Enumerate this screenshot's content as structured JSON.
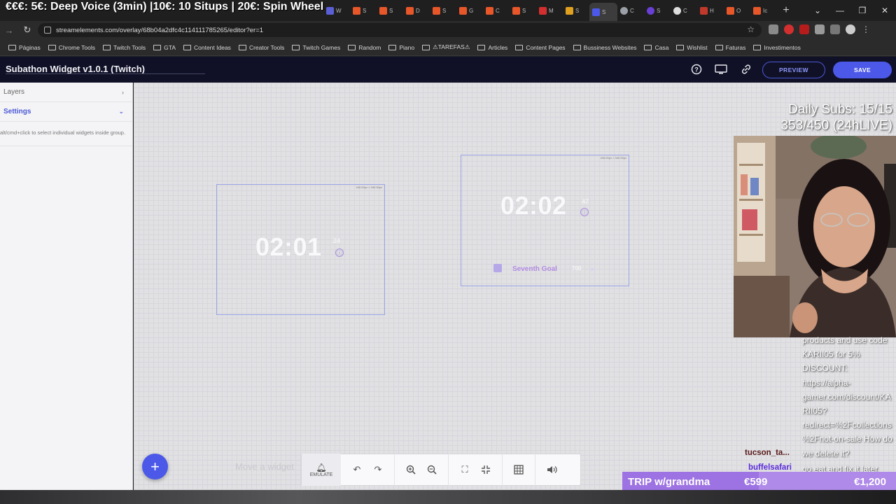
{
  "stream_overlay": {
    "top_banner": "€€€: 5€: Deep Voice (3min) |10€: 10 Situps | 20€: Spin Wheel",
    "subs_line1": "Daily Subs: 15/15",
    "subs_line2": "353/450 (24hLIVE)",
    "chat_text": "products and use code KARII05 for 5% DISCOUNT: https://alpha-gamer.com/discount/KARII05?redirect=%2Fcollections%2Fnot-on-sale How do we delete it?",
    "chat_user1": "tucson_ta...",
    "chat_user2": "buffelsafari",
    "chat_tail": "go eat and fix it later",
    "trip_label": "TRIP w/grandma",
    "trip_current": "€599",
    "trip_goal": "€1,200",
    "trip_progress": 0.499
  },
  "browser": {
    "tabs": [
      "W",
      "S",
      "S",
      "D",
      "S",
      "G",
      "C",
      "S",
      "M",
      "S",
      "S",
      "C",
      "S",
      "C",
      "H",
      "O",
      "Ic"
    ],
    "url": "streamelements.com/overlay/68b04a2dfc4c114111785265/editor?er=1",
    "bookmarks": [
      "Páginas",
      "Chrome Tools",
      "Twitch Tools",
      "GTA",
      "Content Ideas",
      "Creator Tools",
      "Twitch Games",
      "Random",
      "Piano",
      "⚠TAREFAS⚠",
      "Articles",
      "Content Pages",
      "Bussiness Websites",
      "Casa",
      "Wishlist",
      "Faturas",
      "Investimentos"
    ]
  },
  "app": {
    "title": "Subathon Widget v1.0.1 (Twitch)",
    "preview_label": "PREVIEW",
    "save_label": "SAVE"
  },
  "left_panel": {
    "layers_label": "Layers",
    "settings_label": "Settings",
    "hint_text": "alt/cmd+click to select individual widgets inside group."
  },
  "canvas": {
    "widget1": {
      "dims": "440.00px × 340.00px",
      "time": "02:01",
      "seconds": "24"
    },
    "widget2": {
      "dims": "440.00px × 340.00px",
      "time": "02:02",
      "seconds": "47",
      "goal_name": "Seventh Goal",
      "goal_value": "700"
    },
    "move_hint": "Move a widget"
  },
  "toolbar": {
    "emulate_label": "EMULATE"
  }
}
